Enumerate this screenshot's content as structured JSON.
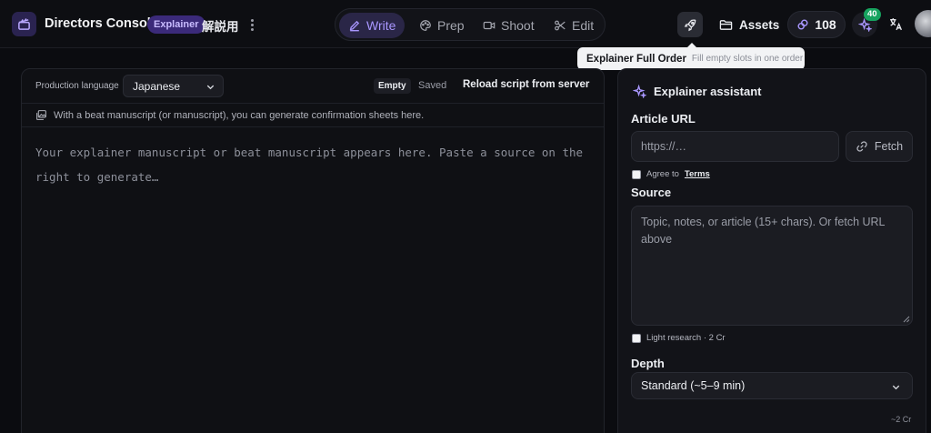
{
  "header": {
    "app_title": "Directors Console",
    "mode_badge": "Explainer",
    "mode_label_jp": "解説用",
    "tabs": [
      {
        "label": "Write",
        "icon": "pencil-icon",
        "active": true
      },
      {
        "label": "Prep",
        "icon": "palette-icon",
        "active": false
      },
      {
        "label": "Shoot",
        "icon": "video-camera-icon",
        "active": false
      },
      {
        "label": "Edit",
        "icon": "scissors-icon",
        "active": false
      }
    ],
    "assets_label": "Assets",
    "credits": "108",
    "notification_count": "40"
  },
  "tooltip": {
    "title": "Explainer Full Order",
    "description": "Fill empty slots in one order"
  },
  "editor": {
    "production_language_label": "Production language",
    "production_language_value": "Japanese",
    "status_empty": "Empty",
    "status_saved": "Saved",
    "reload_label": "Reload script from server",
    "hint": "With a beat manuscript (or manuscript), you can generate confirmation sheets here.",
    "placeholder": "Your explainer manuscript or beat manuscript appears here. Paste a source on the right to generate…"
  },
  "assistant": {
    "title": "Explainer assistant",
    "article_url_label": "Article URL",
    "url_placeholder": "https://…",
    "fetch_label": "Fetch",
    "agree_prefix": "Agree to",
    "terms_label": "Terms",
    "source_label": "Source",
    "source_placeholder": "Topic, notes, or article (15+ chars). Or fetch URL above",
    "light_research_label": "Light research · 2 Cr",
    "depth_label": "Depth",
    "depth_value": "Standard (~5–9 min)",
    "cost_note": "~2 Cr"
  },
  "colors": {
    "accent": "#a997ff",
    "background": "#0b0c10",
    "badge_green": "#17a35f"
  }
}
